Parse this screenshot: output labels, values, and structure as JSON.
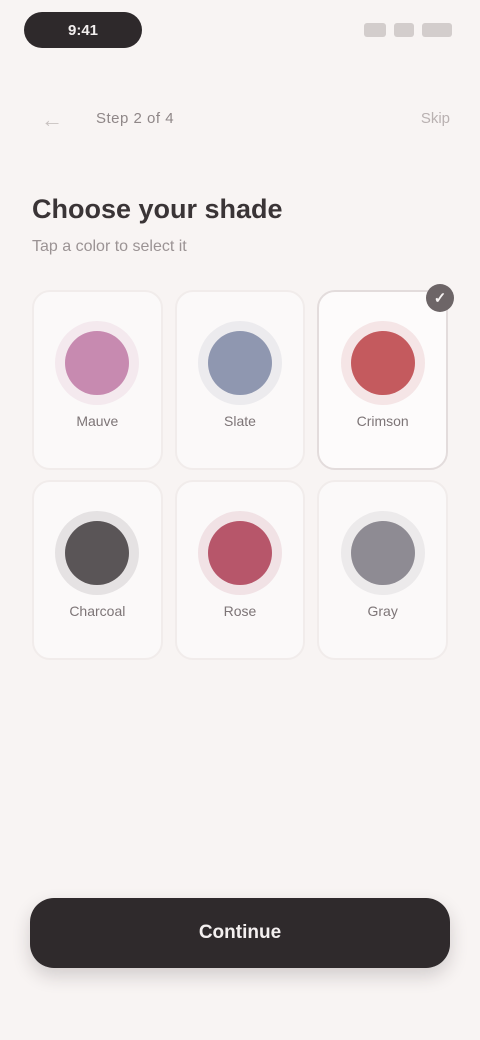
{
  "status_bar": {
    "time": "9:41",
    "icons": [
      "signal-icon",
      "wifi-icon",
      "battery-icon"
    ]
  },
  "nav": {
    "back_icon": "arrow-left-icon",
    "step_label": "Step 2 of 4",
    "skip_label": "Skip"
  },
  "heading": "Choose your shade",
  "subheading": "Tap a color to select it",
  "swatches": [
    {
      "name": "Mauve",
      "color": "#c78ab0",
      "selected": false
    },
    {
      "name": "Slate",
      "color": "#8f97b0",
      "selected": false
    },
    {
      "name": "Crimson",
      "color": "#c45a5e",
      "selected": true
    },
    {
      "name": "Charcoal",
      "color": "#5a5557",
      "selected": false
    },
    {
      "name": "Rose",
      "color": "#b7566a",
      "selected": false
    },
    {
      "name": "Gray",
      "color": "#8e8b93",
      "selected": false
    }
  ],
  "selected_icon": "check-icon",
  "continue_label": "Continue",
  "colors": {
    "background": "#f8f4f3",
    "button": "#2f2a2c",
    "accent": "#6d6567"
  }
}
